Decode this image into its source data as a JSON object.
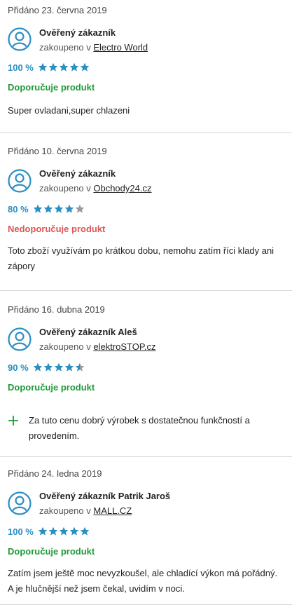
{
  "colors": {
    "rating": "#2a8fc4",
    "positive": "#1e9b3a",
    "negative": "#e05555",
    "star_off": "#9a9a9a"
  },
  "reviews": [
    {
      "date": "Přidáno 23. června 2019",
      "name": "Ověřený zákazník",
      "shop_prefix": "zakoupeno v",
      "shop": "Electro World",
      "percent": "100 %",
      "stars": 5,
      "verdict": "Doporučuje produkt",
      "verdict_type": "positive",
      "text": "Super ovladani,super chlazeni"
    },
    {
      "date": "Přidáno 10. června 2019",
      "name": "Ověřený zákazník",
      "shop_prefix": "zakoupeno v",
      "shop": "Obchody24.cz",
      "percent": "80 %",
      "stars": 4,
      "verdict": "Nedoporučuje produkt",
      "verdict_type": "negative",
      "text": "Toto zboží využívám po krátkou dobu, nemohu zatím říci klady ani zápory"
    },
    {
      "date": "Přidáno 16. dubna 2019",
      "name": "Ověřený zákazník Aleš",
      "shop_prefix": "zakoupeno v",
      "shop": "elektroSTOP.cz",
      "percent": "90 %",
      "stars": 4.5,
      "verdict": "Doporučuje produkt",
      "verdict_type": "positive",
      "pro": "Za tuto cenu dobrý výrobek s dostatečnou funkčností a provedením."
    },
    {
      "date": "Přidáno 24. ledna 2019",
      "name": "Ověřený zákazník Patrik Jaroš",
      "shop_prefix": "zakoupeno v",
      "shop": "MALL.CZ",
      "percent": "100 %",
      "stars": 5,
      "verdict": "Doporučuje produkt",
      "verdict_type": "positive",
      "text": "Zatím jsem ještě moc nevyzkoušel, ale chladící výkon má pořádný. A je hlučnější než jsem čekal, uvidím v noci."
    }
  ]
}
